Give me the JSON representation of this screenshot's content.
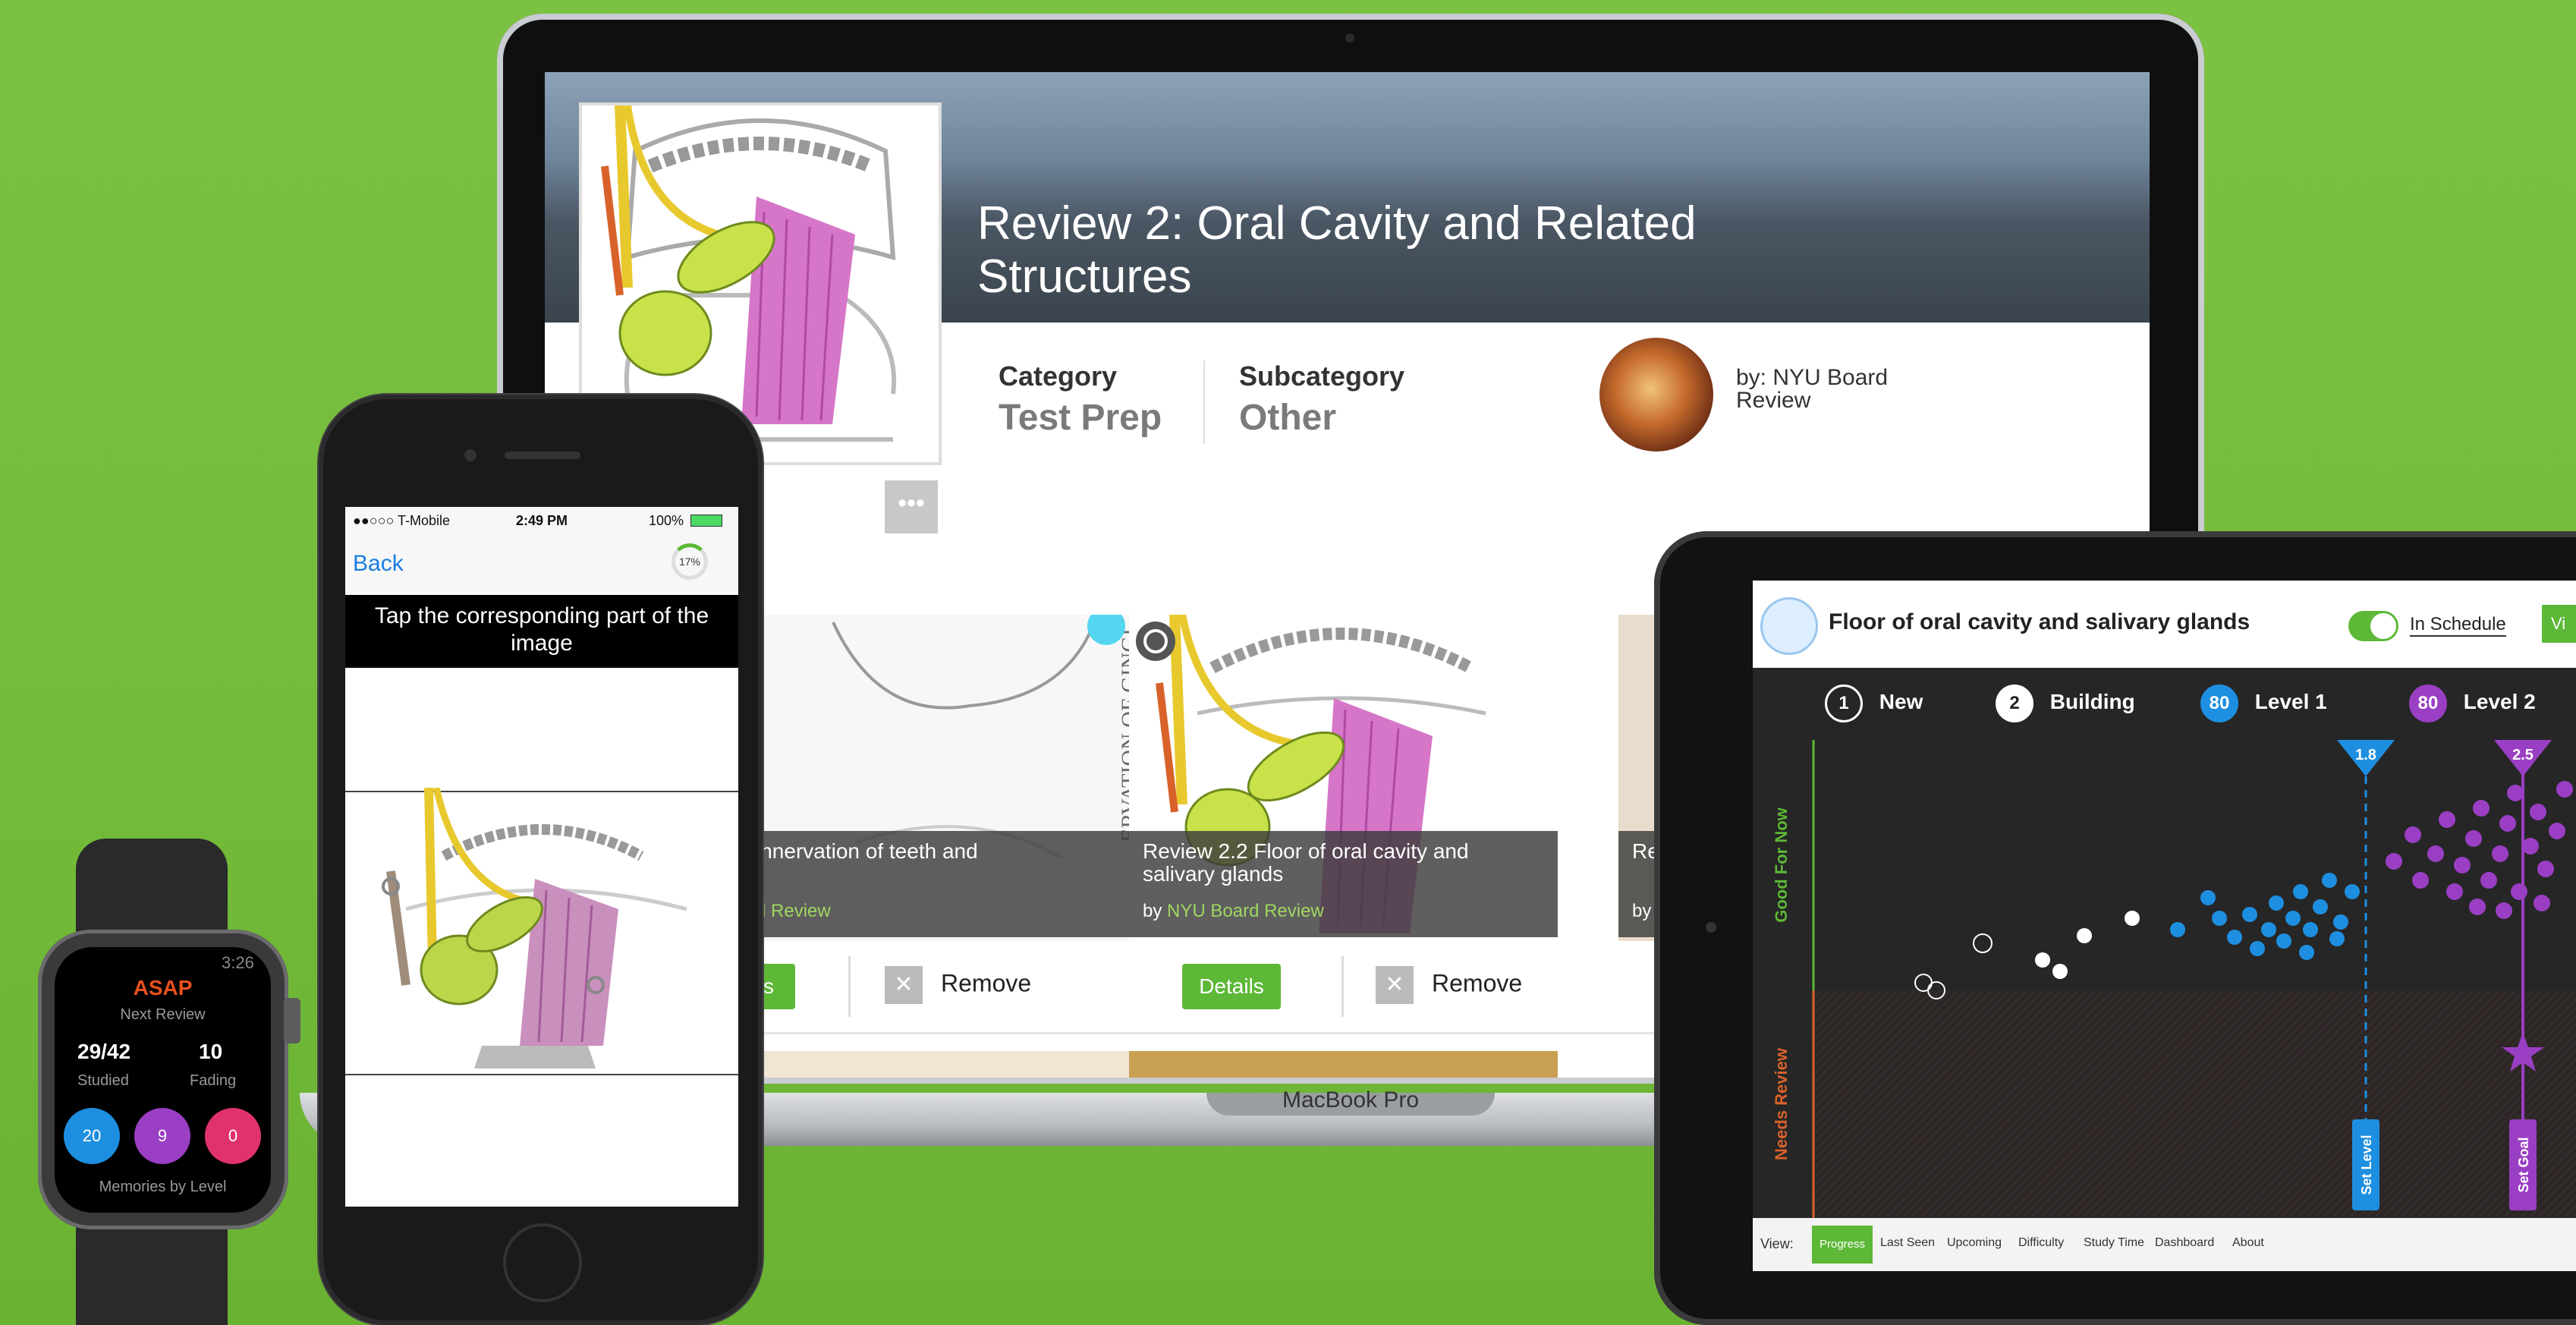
{
  "macbook": {
    "brand_label": "MacBook Pro",
    "deck": {
      "title": "Review 2: Oral Cavity and Related Structures",
      "category_label": "Category",
      "category_value": "Test Prep",
      "subcategory_label": "Subcategory",
      "subcategory_value": "Other",
      "author": "by: NYU Board Review",
      "more_label": "•••"
    },
    "cards": [
      {
        "title": "innervation of teeth and",
        "by": "d Review",
        "details_label": "s",
        "remove_label": "Remove"
      },
      {
        "title": "Review 2.2 Floor of oral cavity and salivary glands",
        "by_prefix": "by",
        "by": "NYU Board Review",
        "details_label": "Details",
        "remove_label": "Remove"
      },
      {
        "title": "Re",
        "by": "by"
      }
    ]
  },
  "iphone": {
    "carrier": "●●○○○ T-Mobile",
    "time": "2:49 PM",
    "battery": "100%",
    "back_label": "Back",
    "progress_label": "17%",
    "prompt": "Tap the corresponding part of the image"
  },
  "watch": {
    "time": "3:26",
    "title": "ASAP",
    "subtitle": "Next Review",
    "studied_value": "29/42",
    "studied_label": "Studied",
    "fading_value": "10",
    "fading_label": "Fading",
    "levels": [
      {
        "value": "20",
        "color": "#1e8fe0"
      },
      {
        "value": "9",
        "color": "#9a3fc4"
      },
      {
        "value": "0",
        "color": "#e0326d"
      }
    ],
    "footer": "Memories by Level"
  },
  "ipad": {
    "title": "Floor of oral cavity and salivary glands",
    "schedule_label": "In Schedule",
    "view_button": "Vi",
    "legend": [
      {
        "num": "1",
        "label": "New"
      },
      {
        "num": "2",
        "label": "Building"
      },
      {
        "num": "80",
        "label": "Level 1",
        "color": "#1e8fe0"
      },
      {
        "num": "80",
        "label": "Level 2",
        "color": "#9a3fc4"
      }
    ],
    "chart": {
      "y_top_label": "Good For Now",
      "y_bottom_label": "Needs Review",
      "marker_blue": "1.8",
      "marker_purple": "2.5",
      "set_level_label": "Set Level",
      "set_goal_label": "Set Goal"
    },
    "view_bar": {
      "label": "View:",
      "tabs": [
        "Progress",
        "Last Seen",
        "Upcoming",
        "Difficulty",
        "Study Time",
        "Dashboard",
        "About"
      ]
    }
  },
  "colors": {
    "background": "#76bd3c",
    "accent_green": "#5cb836",
    "level1": "#1e8fe0",
    "level2": "#9a3fc4",
    "watch_title": "#e8501e"
  }
}
